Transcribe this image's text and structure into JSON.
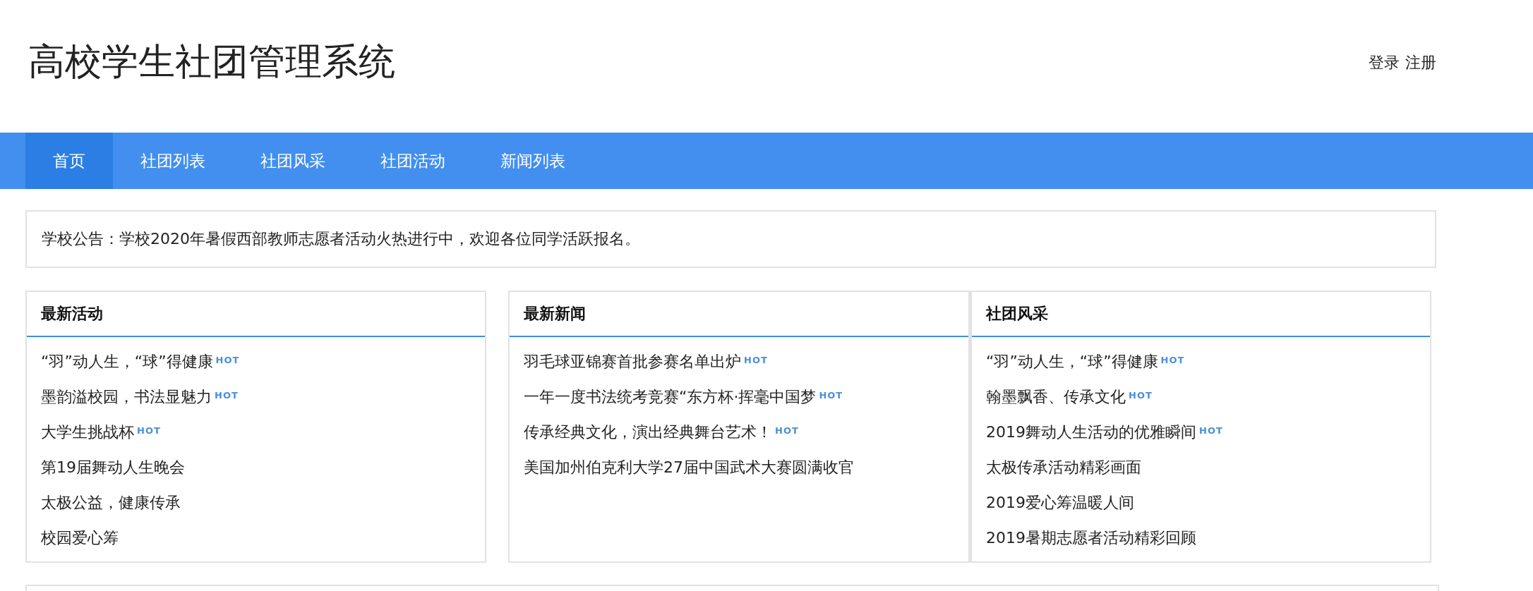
{
  "header": {
    "title": "高校学生社团管理系统",
    "auth_links": [
      "登录",
      "注册"
    ]
  },
  "nav": [
    {
      "label": "首页",
      "selected": true
    },
    {
      "label": "社团列表",
      "selected": false
    },
    {
      "label": "社团风采",
      "selected": false
    },
    {
      "label": "社团活动",
      "selected": false
    },
    {
      "label": "新闻列表",
      "selected": false
    }
  ],
  "notice": "学校公告：学校2020年暑假西部教师志愿者活动火热进行中，欢迎各位同学活跃报名。",
  "panels": [
    {
      "title": "最新活动",
      "items": [
        {
          "text": "“羽”动人生，“球”得健康",
          "badge": "HOT"
        },
        {
          "text": "墨韵溢校园，书法显魅力",
          "badge": "HOT"
        },
        {
          "text": "大学生挑战杯",
          "badge": "HOT"
        },
        {
          "text": "第19届舞动人生晚会"
        },
        {
          "text": "太极公益，健康传承"
        },
        {
          "text": "校园爱心筹"
        }
      ]
    },
    {
      "title": "最新新闻",
      "items": [
        {
          "text": "羽毛球亚锦赛首批参赛名单出炉",
          "badge": "HOT"
        },
        {
          "text": "一年一度书法统考竞赛“东方杯·挥毫中国梦",
          "badge": "HOT"
        },
        {
          "text": "传承经典文化，演出经典舞台艺术！",
          "badge": "HOT"
        },
        {
          "text": "美国加州伯克利大学27届中国武术大赛圆满收官"
        }
      ]
    },
    {
      "title": "社团风采",
      "items": [
        {
          "text": "“羽”动人生，“球”得健康",
          "badge": "HOT"
        },
        {
          "text": "翰墨飘香、传承文化",
          "badge": "HOT"
        },
        {
          "text": "2019舞动人生活动的优雅瞬间",
          "badge": "HOT"
        },
        {
          "text": "太极传承活动精彩画面"
        },
        {
          "text": "2019爱心筹温暖人间"
        },
        {
          "text": "2019暑期志愿者活动精彩回顾"
        }
      ]
    }
  ]
}
